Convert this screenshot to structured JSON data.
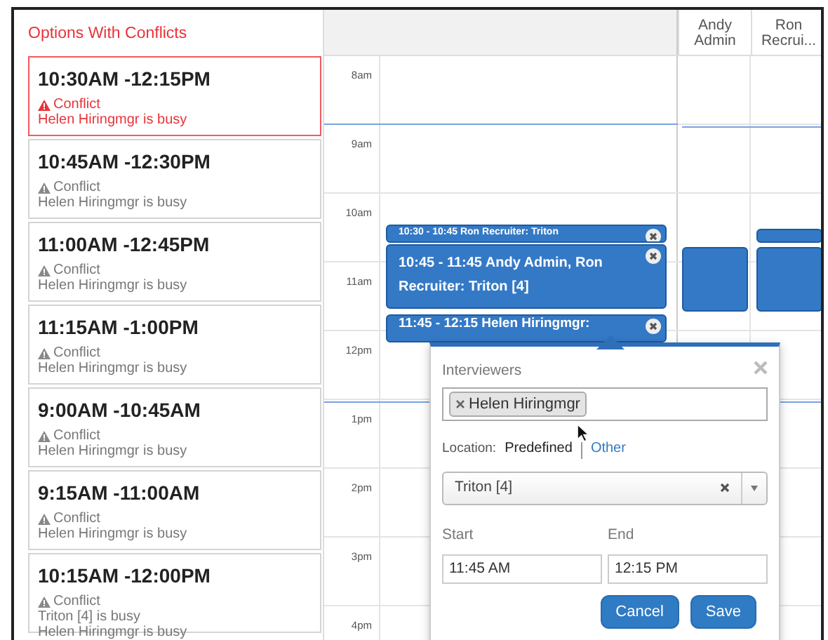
{
  "panel": {
    "title": "Options With Conflicts",
    "options": [
      {
        "time": "10:30AM -12:15PM",
        "selected": true,
        "conflict_label": "Conflict",
        "reasons": [
          "Helen Hiringmgr is busy"
        ]
      },
      {
        "time": "10:45AM -12:30PM",
        "selected": false,
        "conflict_label": "Conflict",
        "reasons": [
          "Helen Hiringmgr is busy"
        ]
      },
      {
        "time": "11:00AM -12:45PM",
        "selected": false,
        "conflict_label": "Conflict",
        "reasons": [
          "Helen Hiringmgr is busy"
        ]
      },
      {
        "time": "11:15AM -1:00PM",
        "selected": false,
        "conflict_label": "Conflict",
        "reasons": [
          "Helen Hiringmgr is busy"
        ]
      },
      {
        "time": "9:00AM -10:45AM",
        "selected": false,
        "conflict_label": "Conflict",
        "reasons": [
          "Helen Hiringmgr is busy"
        ]
      },
      {
        "time": "9:15AM -11:00AM",
        "selected": false,
        "conflict_label": "Conflict",
        "reasons": [
          "Helen Hiringmgr is busy"
        ]
      },
      {
        "time": "10:15AM -12:00PM",
        "selected": false,
        "conflict_label": "Conflict",
        "reasons": [
          "Triton [4] is busy",
          "Helen Hiringmgr is busy"
        ]
      }
    ]
  },
  "calendar": {
    "columns": [
      "Andy Admin",
      "Ron Recrui..."
    ],
    "hours": [
      "8am",
      "9am",
      "10am",
      "11am",
      "12pm",
      "1pm",
      "2pm",
      "3pm",
      "4pm"
    ],
    "events": [
      {
        "text": "10:30 - 10:45 Ron Recruiter: Triton"
      },
      {
        "text": "10:45 - 11:45 Andy Admin, Ron Recruiter: Triton [4]"
      },
      {
        "text": "11:45 - 12:15 Helen Hiringmgr:"
      }
    ]
  },
  "popover": {
    "interviewers_label": "Interviewers",
    "tags": [
      "Helen Hiringmgr"
    ],
    "location_label": "Location:",
    "location_options": [
      {
        "label": "Predefined",
        "selected": true
      },
      {
        "label": "Other",
        "selected": false
      }
    ],
    "location_value": "Triton [4]",
    "start_label": "Start",
    "start_value": "11:45 AM",
    "end_label": "End",
    "end_value": "12:15 PM",
    "buttons": [
      "Cancel",
      "Save"
    ]
  }
}
